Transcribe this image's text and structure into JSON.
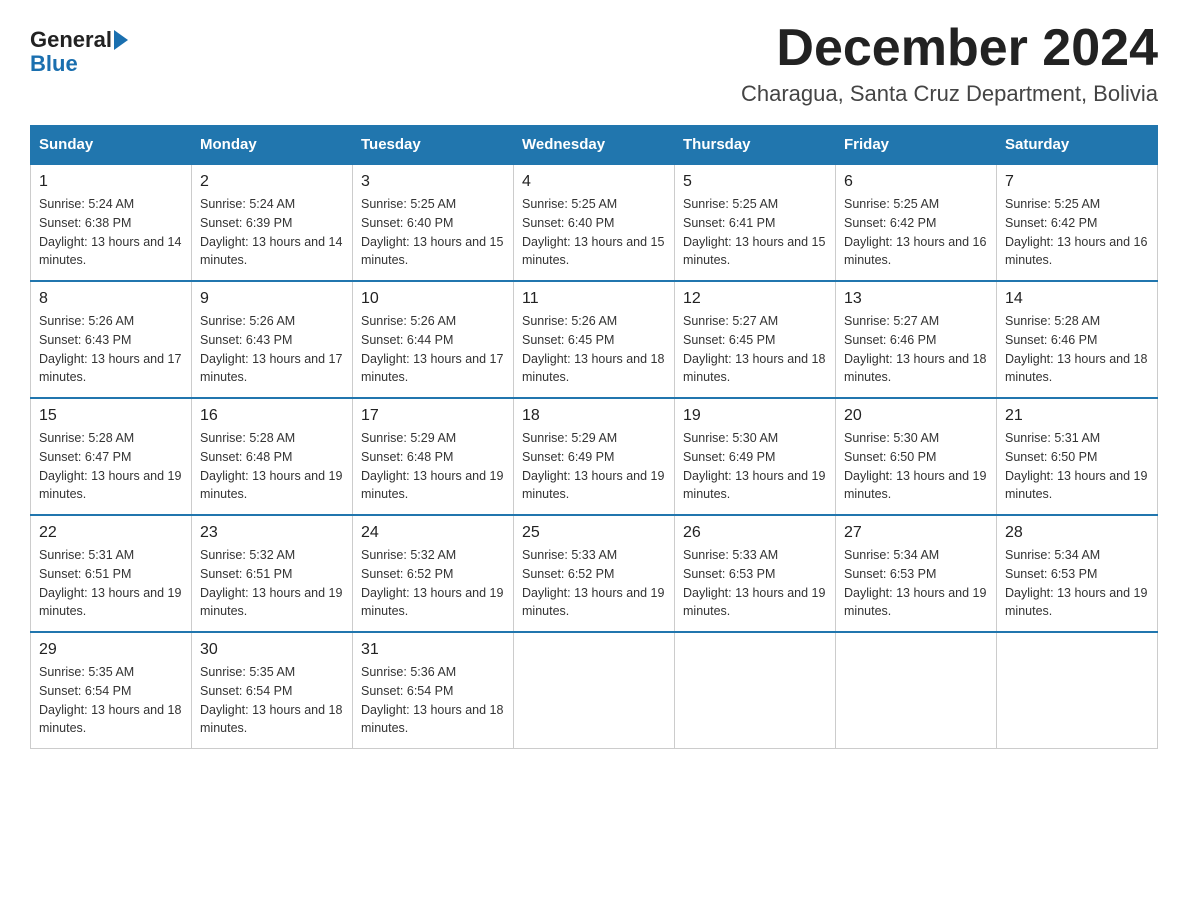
{
  "logo": {
    "text_general": "General",
    "text_blue": "Blue"
  },
  "title": "December 2024",
  "subtitle": "Charagua, Santa Cruz Department, Bolivia",
  "days_of_week": [
    "Sunday",
    "Monday",
    "Tuesday",
    "Wednesday",
    "Thursday",
    "Friday",
    "Saturday"
  ],
  "weeks": [
    [
      {
        "day": "1",
        "sunrise": "Sunrise: 5:24 AM",
        "sunset": "Sunset: 6:38 PM",
        "daylight": "Daylight: 13 hours and 14 minutes."
      },
      {
        "day": "2",
        "sunrise": "Sunrise: 5:24 AM",
        "sunset": "Sunset: 6:39 PM",
        "daylight": "Daylight: 13 hours and 14 minutes."
      },
      {
        "day": "3",
        "sunrise": "Sunrise: 5:25 AM",
        "sunset": "Sunset: 6:40 PM",
        "daylight": "Daylight: 13 hours and 15 minutes."
      },
      {
        "day": "4",
        "sunrise": "Sunrise: 5:25 AM",
        "sunset": "Sunset: 6:40 PM",
        "daylight": "Daylight: 13 hours and 15 minutes."
      },
      {
        "day": "5",
        "sunrise": "Sunrise: 5:25 AM",
        "sunset": "Sunset: 6:41 PM",
        "daylight": "Daylight: 13 hours and 15 minutes."
      },
      {
        "day": "6",
        "sunrise": "Sunrise: 5:25 AM",
        "sunset": "Sunset: 6:42 PM",
        "daylight": "Daylight: 13 hours and 16 minutes."
      },
      {
        "day": "7",
        "sunrise": "Sunrise: 5:25 AM",
        "sunset": "Sunset: 6:42 PM",
        "daylight": "Daylight: 13 hours and 16 minutes."
      }
    ],
    [
      {
        "day": "8",
        "sunrise": "Sunrise: 5:26 AM",
        "sunset": "Sunset: 6:43 PM",
        "daylight": "Daylight: 13 hours and 17 minutes."
      },
      {
        "day": "9",
        "sunrise": "Sunrise: 5:26 AM",
        "sunset": "Sunset: 6:43 PM",
        "daylight": "Daylight: 13 hours and 17 minutes."
      },
      {
        "day": "10",
        "sunrise": "Sunrise: 5:26 AM",
        "sunset": "Sunset: 6:44 PM",
        "daylight": "Daylight: 13 hours and 17 minutes."
      },
      {
        "day": "11",
        "sunrise": "Sunrise: 5:26 AM",
        "sunset": "Sunset: 6:45 PM",
        "daylight": "Daylight: 13 hours and 18 minutes."
      },
      {
        "day": "12",
        "sunrise": "Sunrise: 5:27 AM",
        "sunset": "Sunset: 6:45 PM",
        "daylight": "Daylight: 13 hours and 18 minutes."
      },
      {
        "day": "13",
        "sunrise": "Sunrise: 5:27 AM",
        "sunset": "Sunset: 6:46 PM",
        "daylight": "Daylight: 13 hours and 18 minutes."
      },
      {
        "day": "14",
        "sunrise": "Sunrise: 5:28 AM",
        "sunset": "Sunset: 6:46 PM",
        "daylight": "Daylight: 13 hours and 18 minutes."
      }
    ],
    [
      {
        "day": "15",
        "sunrise": "Sunrise: 5:28 AM",
        "sunset": "Sunset: 6:47 PM",
        "daylight": "Daylight: 13 hours and 19 minutes."
      },
      {
        "day": "16",
        "sunrise": "Sunrise: 5:28 AM",
        "sunset": "Sunset: 6:48 PM",
        "daylight": "Daylight: 13 hours and 19 minutes."
      },
      {
        "day": "17",
        "sunrise": "Sunrise: 5:29 AM",
        "sunset": "Sunset: 6:48 PM",
        "daylight": "Daylight: 13 hours and 19 minutes."
      },
      {
        "day": "18",
        "sunrise": "Sunrise: 5:29 AM",
        "sunset": "Sunset: 6:49 PM",
        "daylight": "Daylight: 13 hours and 19 minutes."
      },
      {
        "day": "19",
        "sunrise": "Sunrise: 5:30 AM",
        "sunset": "Sunset: 6:49 PM",
        "daylight": "Daylight: 13 hours and 19 minutes."
      },
      {
        "day": "20",
        "sunrise": "Sunrise: 5:30 AM",
        "sunset": "Sunset: 6:50 PM",
        "daylight": "Daylight: 13 hours and 19 minutes."
      },
      {
        "day": "21",
        "sunrise": "Sunrise: 5:31 AM",
        "sunset": "Sunset: 6:50 PM",
        "daylight": "Daylight: 13 hours and 19 minutes."
      }
    ],
    [
      {
        "day": "22",
        "sunrise": "Sunrise: 5:31 AM",
        "sunset": "Sunset: 6:51 PM",
        "daylight": "Daylight: 13 hours and 19 minutes."
      },
      {
        "day": "23",
        "sunrise": "Sunrise: 5:32 AM",
        "sunset": "Sunset: 6:51 PM",
        "daylight": "Daylight: 13 hours and 19 minutes."
      },
      {
        "day": "24",
        "sunrise": "Sunrise: 5:32 AM",
        "sunset": "Sunset: 6:52 PM",
        "daylight": "Daylight: 13 hours and 19 minutes."
      },
      {
        "day": "25",
        "sunrise": "Sunrise: 5:33 AM",
        "sunset": "Sunset: 6:52 PM",
        "daylight": "Daylight: 13 hours and 19 minutes."
      },
      {
        "day": "26",
        "sunrise": "Sunrise: 5:33 AM",
        "sunset": "Sunset: 6:53 PM",
        "daylight": "Daylight: 13 hours and 19 minutes."
      },
      {
        "day": "27",
        "sunrise": "Sunrise: 5:34 AM",
        "sunset": "Sunset: 6:53 PM",
        "daylight": "Daylight: 13 hours and 19 minutes."
      },
      {
        "day": "28",
        "sunrise": "Sunrise: 5:34 AM",
        "sunset": "Sunset: 6:53 PM",
        "daylight": "Daylight: 13 hours and 19 minutes."
      }
    ],
    [
      {
        "day": "29",
        "sunrise": "Sunrise: 5:35 AM",
        "sunset": "Sunset: 6:54 PM",
        "daylight": "Daylight: 13 hours and 18 minutes."
      },
      {
        "day": "30",
        "sunrise": "Sunrise: 5:35 AM",
        "sunset": "Sunset: 6:54 PM",
        "daylight": "Daylight: 13 hours and 18 minutes."
      },
      {
        "day": "31",
        "sunrise": "Sunrise: 5:36 AM",
        "sunset": "Sunset: 6:54 PM",
        "daylight": "Daylight: 13 hours and 18 minutes."
      },
      null,
      null,
      null,
      null
    ]
  ]
}
